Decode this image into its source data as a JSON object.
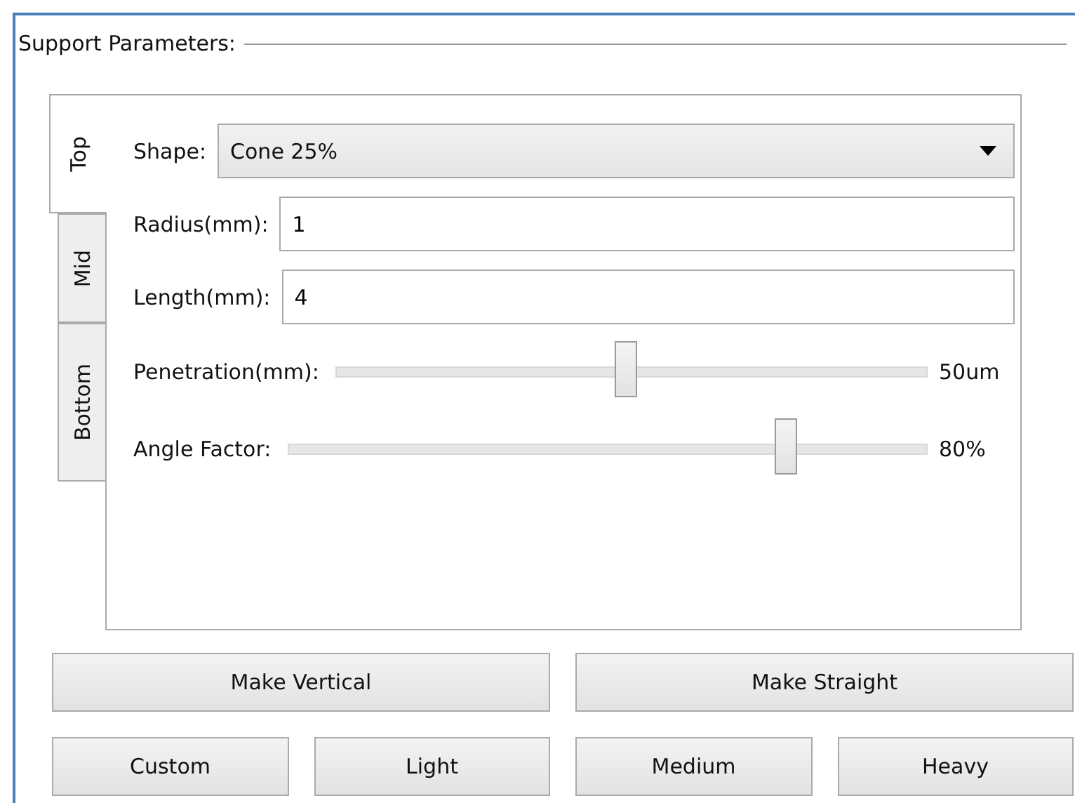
{
  "group": {
    "title": "Support Parameters:"
  },
  "tabs": [
    {
      "label": "Top",
      "selected": true
    },
    {
      "label": "Mid",
      "selected": false
    },
    {
      "label": "Bottom",
      "selected": false
    }
  ],
  "shape": {
    "label": "Shape:",
    "value": "Cone 25%"
  },
  "fields": [
    {
      "label": "Radius(mm):",
      "value": "1"
    },
    {
      "label": "Length(mm):",
      "value": "4"
    }
  ],
  "sliders": [
    {
      "label": "Penetration(mm):",
      "level": 0.49,
      "reading": "50um"
    },
    {
      "label": "Angle Factor:",
      "level": 0.78,
      "reading": "80%"
    }
  ],
  "button_rows": [
    [
      "Make Vertical",
      "Make Straight"
    ],
    [
      "Custom",
      "Light",
      "Medium",
      "Heavy"
    ]
  ]
}
